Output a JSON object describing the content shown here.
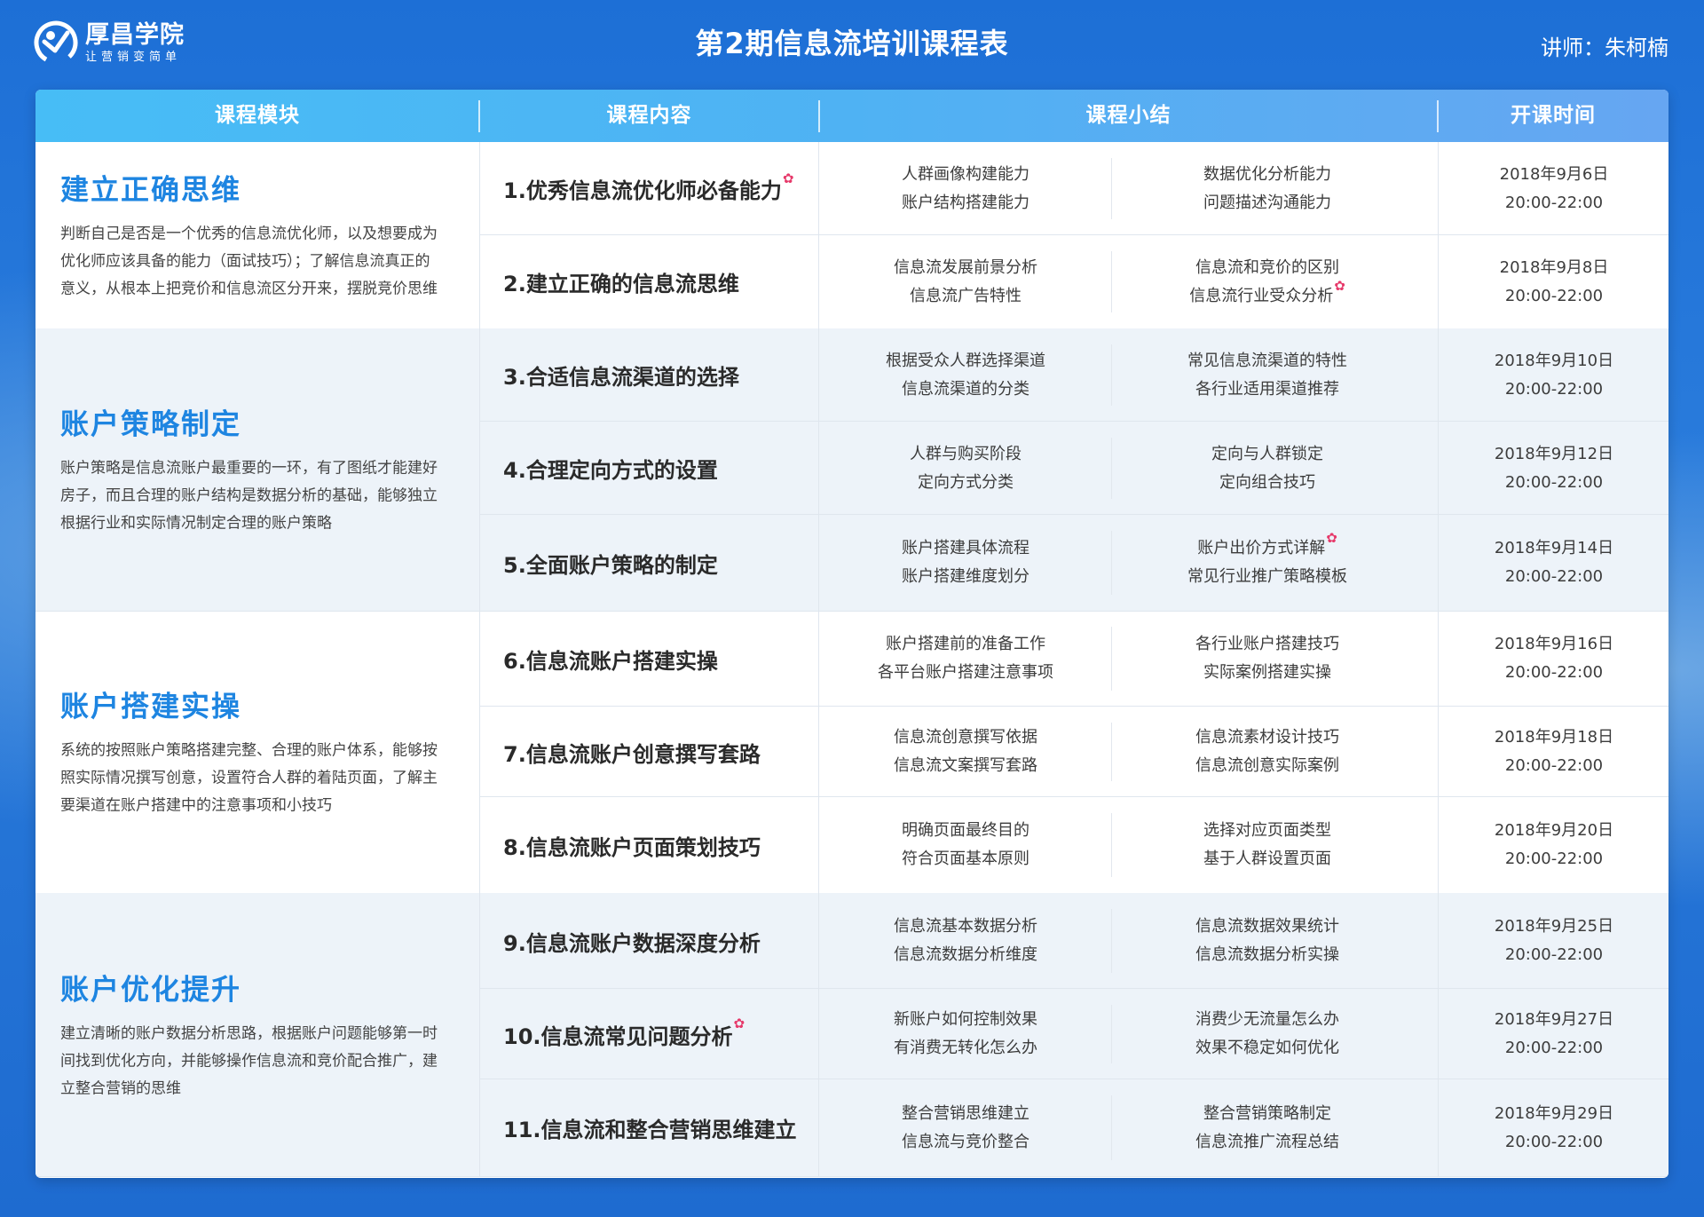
{
  "header": {
    "logo_name": "厚昌学院",
    "logo_slogan": "让营销变简单",
    "title": "第2期信息流培训课程表",
    "lecturer": "讲师：朱柯楠"
  },
  "table": {
    "columns": [
      "课程模块",
      "课程内容",
      "课程小结",
      "开课时间"
    ],
    "modules": [
      {
        "title": "建立正确思维",
        "desc": "判断自己是否是一个优秀的信息流优化师，以及想要成为优化师应该具备的能力（面试技巧）；了解信息流真正的意义，从根本上把竞价和信息流区分开来，摆脱竞价思维",
        "lessons": [
          {
            "title": "1.优秀信息流优化师必备能力",
            "star": true,
            "summary_a": [
              "人群画像构建能力",
              "账户结构搭建能力"
            ],
            "summary_b": [
              "数据优化分析能力",
              "问题描述沟通能力"
            ],
            "star_b": false,
            "date": "2018年9月6日",
            "time": "20:00-22:00"
          },
          {
            "title": "2.建立正确的信息流思维",
            "star": false,
            "summary_a": [
              "信息流发展前景分析",
              "信息流广告特性"
            ],
            "summary_b": [
              "信息流和竞价的区别",
              "信息流行业受众分析"
            ],
            "star_b": true,
            "date": "2018年9月8日",
            "time": "20:00-22:00"
          }
        ]
      },
      {
        "title": "账户策略制定",
        "desc": "账户策略是信息流账户最重要的一环，有了图纸才能建好房子，而且合理的账户结构是数据分析的基础，能够独立根据行业和实际情况制定合理的账户策略",
        "lessons": [
          {
            "title": "3.合适信息流渠道的选择",
            "star": false,
            "summary_a": [
              "根据受众人群选择渠道",
              "信息流渠道的分类"
            ],
            "summary_b": [
              "常见信息流渠道的特性",
              "各行业适用渠道推荐"
            ],
            "star_b": false,
            "date": "2018年9月10日",
            "time": "20:00-22:00"
          },
          {
            "title": "4.合理定向方式的设置",
            "star": false,
            "summary_a": [
              "人群与购买阶段",
              "定向方式分类"
            ],
            "summary_b": [
              "定向与人群锁定",
              "定向组合技巧"
            ],
            "star_b": false,
            "date": "2018年9月12日",
            "time": "20:00-22:00"
          },
          {
            "title": "5.全面账户策略的制定",
            "star": false,
            "summary_a": [
              "账户搭建具体流程",
              "账户搭建维度划分"
            ],
            "summary_b": [
              "账户出价方式详解",
              "常见行业推广策略模板"
            ],
            "star_b": true,
            "date": "2018年9月14日",
            "time": "20:00-22:00"
          }
        ]
      },
      {
        "title": "账户搭建实操",
        "desc": "系统的按照账户策略搭建完整、合理的账户体系，能够按照实际情况撰写创意，设置符合人群的着陆页面，了解主要渠道在账户搭建中的注意事项和小技巧",
        "lessons": [
          {
            "title": "6.信息流账户搭建实操",
            "star": false,
            "summary_a": [
              "账户搭建前的准备工作",
              "各平台账户搭建注意事项"
            ],
            "summary_b": [
              "各行业账户搭建技巧",
              "实际案例搭建实操"
            ],
            "star_b": false,
            "date": "2018年9月16日",
            "time": "20:00-22:00"
          },
          {
            "title": "7.信息流账户创意撰写套路",
            "star": false,
            "summary_a": [
              "信息流创意撰写依据",
              "信息流文案撰写套路"
            ],
            "summary_b": [
              "信息流素材设计技巧",
              "信息流创意实际案例"
            ],
            "star_b": false,
            "date": "2018年9月18日",
            "time": "20:00-22:00"
          },
          {
            "title": "8.信息流账户页面策划技巧",
            "star": false,
            "summary_a": [
              "明确页面最终目的",
              "符合页面基本原则"
            ],
            "summary_b": [
              "选择对应页面类型",
              "基于人群设置页面"
            ],
            "star_b": false,
            "date": "2018年9月20日",
            "time": "20:00-22:00"
          }
        ]
      },
      {
        "title": "账户优化提升",
        "desc": "建立清晰的账户数据分析思路，根据账户问题能够第一时间找到优化方向，并能够操作信息流和竞价配合推广，建立整合营销的思维",
        "lessons": [
          {
            "title": "9.信息流账户数据深度分析",
            "star": false,
            "summary_a": [
              "信息流基本数据分析",
              "信息流数据分析维度"
            ],
            "summary_b": [
              "信息流数据效果统计",
              "信息流数据分析实操"
            ],
            "star_b": false,
            "date": "2018年9月25日",
            "time": "20:00-22:00"
          },
          {
            "title": "10.信息流常见问题分析",
            "star": true,
            "summary_a": [
              "新账户如何控制效果",
              "有消费无转化怎么办"
            ],
            "summary_b": [
              "消费少无流量怎么办",
              "效果不稳定如何优化"
            ],
            "star_b": false,
            "date": "2018年9月27日",
            "time": "20:00-22:00"
          },
          {
            "title": "11.信息流和整合营销思维建立",
            "star": false,
            "summary_a": [
              "整合营销思维建立",
              "信息流与竞价整合"
            ],
            "summary_b": [
              "整合营销策略制定",
              "信息流推广流程总结"
            ],
            "star_b": false,
            "date": "2018年9月29日",
            "time": "20:00-22:00"
          }
        ]
      }
    ]
  },
  "colors": {
    "background": "#1e6fd6",
    "header_gradient_start": "#47bdf6",
    "header_gradient_end": "#66a6f2",
    "module_title": "#1e85e1",
    "star": "#e6396a",
    "shaded_row": "#edf3f9"
  },
  "icons": {
    "logo": "houchang-logo-icon",
    "star": "star-icon"
  }
}
